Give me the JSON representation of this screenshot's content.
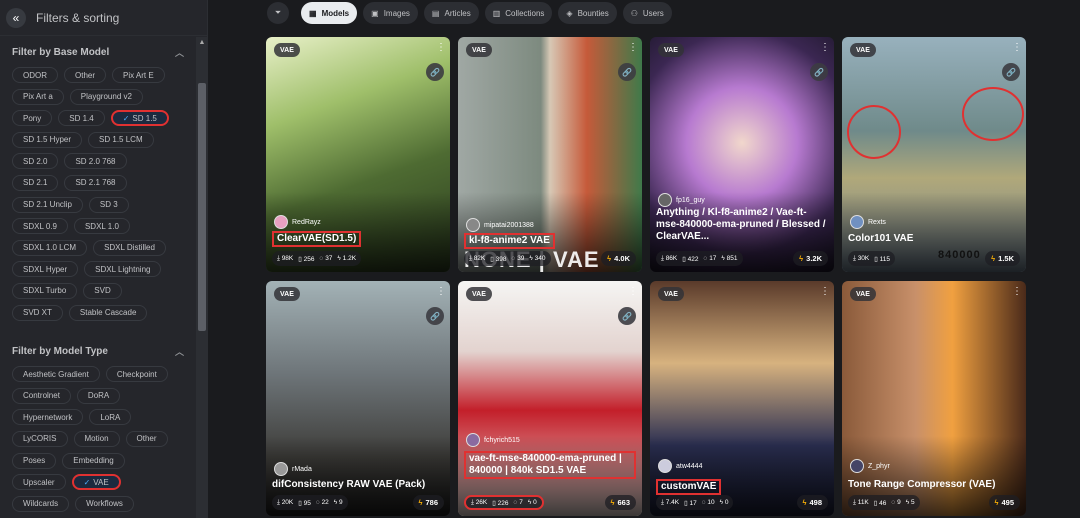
{
  "sidebar": {
    "title": "Filters & sorting",
    "base_model": {
      "heading": "Filter by Base Model",
      "chips": [
        {
          "label": "ODOR",
          "selected": false
        },
        {
          "label": "Other",
          "selected": false
        },
        {
          "label": "Pix Art E",
          "selected": false
        },
        {
          "label": "Pix Art a",
          "selected": false
        },
        {
          "label": "Playground v2",
          "selected": false
        },
        {
          "label": "Pony",
          "selected": false
        },
        {
          "label": "SD 1.4",
          "selected": false
        },
        {
          "label": "SD 1.5",
          "selected": true
        },
        {
          "label": "SD 1.5 Hyper",
          "selected": false
        },
        {
          "label": "SD 1.5 LCM",
          "selected": false
        },
        {
          "label": "SD 2.0",
          "selected": false
        },
        {
          "label": "SD 2.0 768",
          "selected": false
        },
        {
          "label": "SD 2.1",
          "selected": false
        },
        {
          "label": "SD 2.1 768",
          "selected": false
        },
        {
          "label": "SD 2.1 Unclip",
          "selected": false
        },
        {
          "label": "SD 3",
          "selected": false
        },
        {
          "label": "SDXL 0.9",
          "selected": false
        },
        {
          "label": "SDXL 1.0",
          "selected": false
        },
        {
          "label": "SDXL 1.0 LCM",
          "selected": false
        },
        {
          "label": "SDXL Distilled",
          "selected": false
        },
        {
          "label": "SDXL Hyper",
          "selected": false
        },
        {
          "label": "SDXL Lightning",
          "selected": false
        },
        {
          "label": "SDXL Turbo",
          "selected": false
        },
        {
          "label": "SVD",
          "selected": false
        },
        {
          "label": "SVD XT",
          "selected": false
        },
        {
          "label": "Stable Cascade",
          "selected": false
        }
      ]
    },
    "model_type": {
      "heading": "Filter by Model Type",
      "chips": [
        {
          "label": "Aesthetic Gradient",
          "selected": false
        },
        {
          "label": "Checkpoint",
          "selected": false
        },
        {
          "label": "Controlnet",
          "selected": false
        },
        {
          "label": "DoRA",
          "selected": false
        },
        {
          "label": "Hypernetwork",
          "selected": false
        },
        {
          "label": "LoRA",
          "selected": false
        },
        {
          "label": "LyCORIS",
          "selected": false
        },
        {
          "label": "Motion",
          "selected": false
        },
        {
          "label": "Other",
          "selected": false
        },
        {
          "label": "Poses",
          "selected": false
        },
        {
          "label": "Embedding",
          "selected": false
        },
        {
          "label": "Upscaler",
          "selected": false
        },
        {
          "label": "VAE",
          "selected": true
        },
        {
          "label": "Wildcards",
          "selected": false
        },
        {
          "label": "Workflows",
          "selected": false
        }
      ]
    }
  },
  "tabs": [
    {
      "label": "Models",
      "icon": "grid-icon",
      "active": true
    },
    {
      "label": "Images",
      "icon": "image-icon",
      "active": false
    },
    {
      "label": "Articles",
      "icon": "article-icon",
      "active": false
    },
    {
      "label": "Collections",
      "icon": "collection-icon",
      "active": false
    },
    {
      "label": "Bounties",
      "icon": "bag-icon",
      "active": false
    },
    {
      "label": "Users",
      "icon": "users-icon",
      "active": false
    }
  ],
  "cards": [
    {
      "badge": "VAE",
      "user": "RedRayz",
      "title": "ClearVAE(SD1.5)",
      "downloads": "98K",
      "saves": "256",
      "comments": "37",
      "likes": "1.2K",
      "buzz": "",
      "title_boxed": true,
      "stats_boxed": false
    },
    {
      "badge": "VAE",
      "user": "mipatai2001388",
      "title": "kl-f8-anime2 VAE",
      "downloads": "82K",
      "saves": "398",
      "comments": "39",
      "likes": "340",
      "buzz": "4.0K",
      "title_boxed": true,
      "stats_boxed": false
    },
    {
      "badge": "VAE",
      "user": "fp16_guy",
      "title": "Anything / Kl-f8-anime2 / Vae-ft-mse-840000-ema-pruned / Blessed / ClearVAE...",
      "downloads": "86K",
      "saves": "422",
      "comments": "17",
      "likes": "851",
      "buzz": "3.2K",
      "title_boxed": false,
      "stats_boxed": false
    },
    {
      "badge": "VAE",
      "user": "Rexts",
      "title": "Color101 VAE",
      "downloads": "30K",
      "saves": "115",
      "comments": "",
      "likes": "",
      "buzz": "1.5K",
      "title_boxed": false,
      "stats_boxed": false
    },
    {
      "badge": "VAE",
      "user": "rMada",
      "title": "difConsistency RAW VAE (Pack)",
      "downloads": "20K",
      "saves": "95",
      "comments": "22",
      "likes": "9",
      "buzz": "786",
      "title_boxed": false,
      "stats_boxed": false
    },
    {
      "badge": "VAE",
      "user": "fchyrich515",
      "title": "vae-ft-mse-840000-ema-pruned | 840000 | 840k SD1.5 VAE",
      "downloads": "26K",
      "saves": "226",
      "comments": "7",
      "likes": "0",
      "buzz": "663",
      "title_boxed": true,
      "stats_boxed": true
    },
    {
      "badge": "VAE",
      "user": "atw4444",
      "title": "customVAE",
      "downloads": "7.4K",
      "saves": "17",
      "comments": "10",
      "likes": "0",
      "buzz": "498",
      "title_boxed": true,
      "stats_boxed": false
    },
    {
      "badge": "VAE",
      "user": "Z_phyr",
      "title": "Tone Range Compressor (VAE)",
      "downloads": "11K",
      "saves": "46",
      "comments": "9",
      "likes": "5",
      "buzz": "495",
      "title_boxed": false,
      "stats_boxed": false
    }
  ],
  "watermarks": {
    "card2": "NONE | VAE",
    "card4": "840000"
  }
}
